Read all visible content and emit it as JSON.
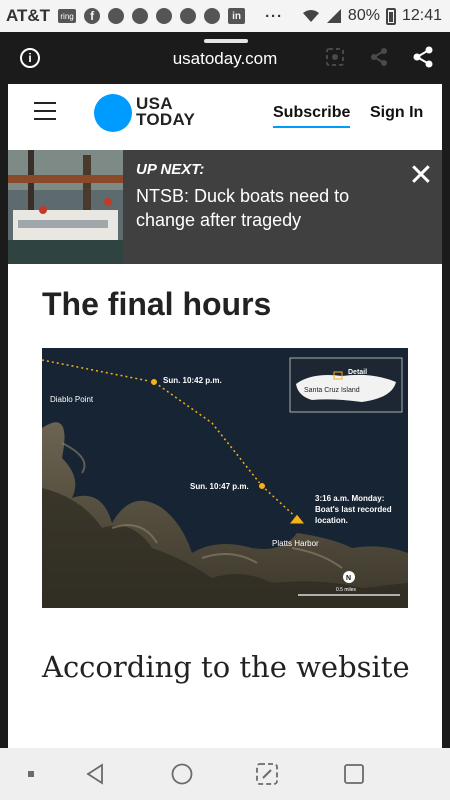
{
  "status_bar": {
    "carrier": "AT&T",
    "ring_label": "ring",
    "linkedin_label": "in",
    "more": "···",
    "battery": "80%",
    "time": "12:41"
  },
  "browser": {
    "info_label": "i",
    "url": "usatoday.com"
  },
  "site": {
    "logo_line1": "USA",
    "logo_line2": "TODAY",
    "subscribe_label": "Subscribe",
    "signin_label": "Sign In"
  },
  "up_next": {
    "label": "UP NEXT:",
    "title": "NTSB: Duck boats need to change after tragedy",
    "close": "✕"
  },
  "article": {
    "headline": "The final hours",
    "body": "According to the website"
  },
  "map": {
    "labels": {
      "diablo_point": "Diablo Point",
      "sun_1042": "Sun. 10:42 p.m.",
      "sun_1047": "Sun. 10:47 p.m.",
      "monday_line1": "3:16 a.m. Monday:",
      "monday_line2": "Boat's last recorded",
      "monday_line3": "location.",
      "platts_harbor": "Platts Harbor",
      "detail": "Detail",
      "santa_cruz": "Santa Cruz Island",
      "north": "N",
      "scale": "0.5 miles"
    }
  },
  "colors": {
    "brand_blue": "#009bff",
    "upnext_bg": "#404040",
    "route": "#f2b21b"
  }
}
